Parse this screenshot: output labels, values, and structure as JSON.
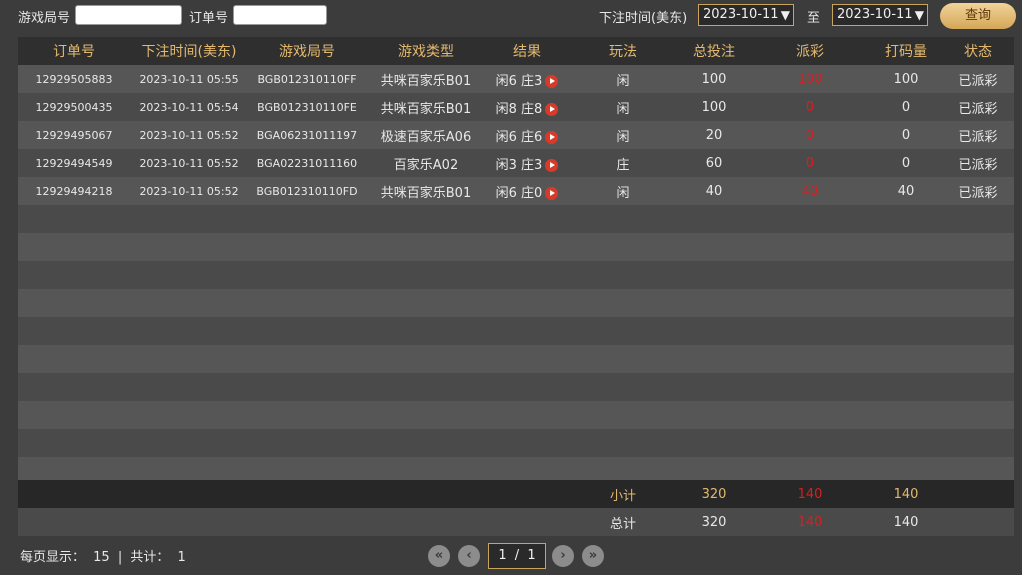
{
  "filters": {
    "round_label": "游戏局号",
    "round_value": "",
    "order_label": "订单号",
    "order_value": "",
    "time_label": "下注时间(美东)",
    "date_from": "2023-10-11",
    "to_label": "至",
    "date_to": "2023-10-11",
    "query_label": "查询"
  },
  "table": {
    "headers": [
      "订单号",
      "下注时间(美东)",
      "游戏局号",
      "游戏类型",
      "结果",
      "玩法",
      "总投注",
      "派彩",
      "打码量",
      "状态"
    ],
    "rows": [
      {
        "order": "12929505883",
        "time": "2023-10-11 05:55",
        "round": "BGB012310110FF",
        "game": "共咪百家乐B01",
        "result": "闲6 庄3",
        "play": "闲",
        "bet": "100",
        "payout": "100",
        "rolling": "100",
        "status": "已派彩"
      },
      {
        "order": "12929500435",
        "time": "2023-10-11 05:54",
        "round": "BGB012310110FE",
        "game": "共咪百家乐B01",
        "result": "闲8 庄8",
        "play": "闲",
        "bet": "100",
        "payout": "0",
        "rolling": "0",
        "status": "已派彩"
      },
      {
        "order": "12929495067",
        "time": "2023-10-11 05:52",
        "round": "BGA06231011197",
        "game": "极速百家乐A06",
        "result": "闲6 庄6",
        "play": "闲",
        "bet": "20",
        "payout": "0",
        "rolling": "0",
        "status": "已派彩"
      },
      {
        "order": "12929494549",
        "time": "2023-10-11 05:52",
        "round": "BGA02231011160",
        "game": "百家乐A02",
        "result": "闲3 庄3",
        "play": "庄",
        "bet": "60",
        "payout": "0",
        "rolling": "0",
        "status": "已派彩"
      },
      {
        "order": "12929494218",
        "time": "2023-10-11 05:52",
        "round": "BGB012310110FD",
        "game": "共咪百家乐B01",
        "result": "闲6 庄0",
        "play": "闲",
        "bet": "40",
        "payout": "40",
        "rolling": "40",
        "status": "已派彩"
      }
    ],
    "empty_rows": 10
  },
  "summary": {
    "subtotal_label": "小计",
    "subtotal_bet": "320",
    "subtotal_payout": "140",
    "subtotal_rolling": "140",
    "total_label": "总计",
    "total_bet": "320",
    "total_payout": "140",
    "total_rolling": "140"
  },
  "footer": {
    "per_page_label": "每页显示：",
    "per_page": "15",
    "sep": "|",
    "total_label": "共计：",
    "total": "1"
  },
  "pager": {
    "current": "1",
    "sep": "/",
    "pages": "1",
    "icons": [
      "first-page-icon",
      "prev-page-icon",
      "next-page-icon",
      "last-page-icon"
    ]
  },
  "colors": {
    "accent": "#e4b96e",
    "payout": "#d42020",
    "play_icon": "#d83a2a"
  }
}
